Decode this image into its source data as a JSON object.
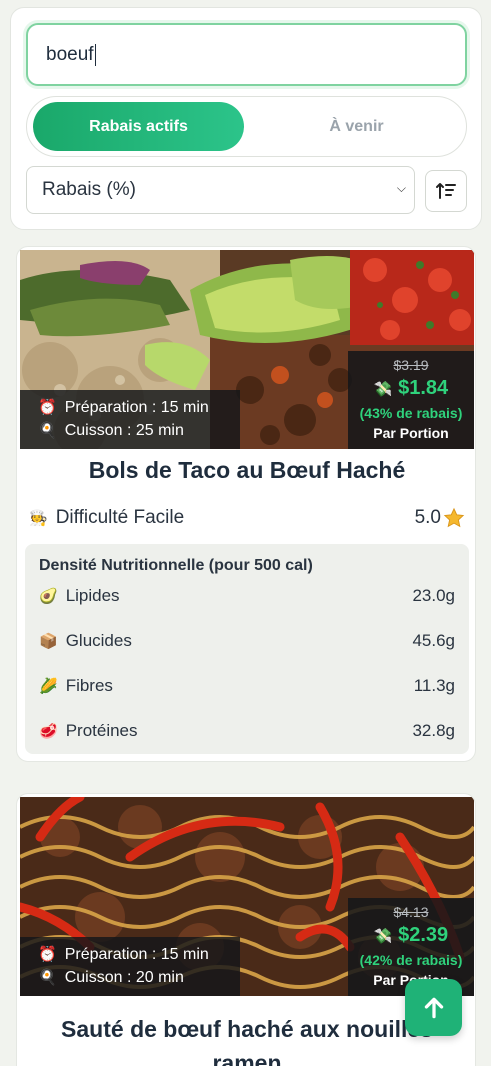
{
  "search": {
    "value": "boeuf"
  },
  "tabs": {
    "active": "Rabais actifs",
    "upcoming": "À venir"
  },
  "sort": {
    "selected": "Rabais (%)"
  },
  "icons": {
    "sort": "sort-ascending-icon",
    "clock": "alarm-clock-icon",
    "pan": "frying-pan-icon",
    "money": "money-icon",
    "chef": "cook-icon",
    "star": "star-icon",
    "avocado": "avocado-icon",
    "box": "package-icon",
    "corn": "corn-icon",
    "meat": "meat-icon",
    "up": "arrow-up-icon"
  },
  "colors": {
    "accent": "#1fb277",
    "discount": "#2fd27c"
  },
  "recipes": [
    {
      "prep": "Préparation : 15 min",
      "cook": "Cuisson : 25 min",
      "old_price": "$3.19",
      "new_price": "$1.84",
      "discount": "(43% de rabais)",
      "per": "Par Portion",
      "title": "Bols de Taco au Bœuf Haché",
      "difficulty": "Difficulté Facile",
      "rating": "5.0",
      "nutrition_title": "Densité Nutritionnelle (pour 500 cal)",
      "nutrition": [
        {
          "label": "Lipides",
          "value": "23.0g"
        },
        {
          "label": "Glucides",
          "value": "45.6g"
        },
        {
          "label": "Fibres",
          "value": "11.3g"
        },
        {
          "label": "Protéines",
          "value": "32.8g"
        }
      ]
    },
    {
      "prep": "Préparation : 15 min",
      "cook": "Cuisson : 20 min",
      "old_price": "$4.13",
      "new_price": "$2.39",
      "discount": "(42% de rabais)",
      "per": "Par Portion",
      "title_line1": "Sauté de bœuf haché aux nouilles",
      "title_line2": "ramen"
    }
  ]
}
